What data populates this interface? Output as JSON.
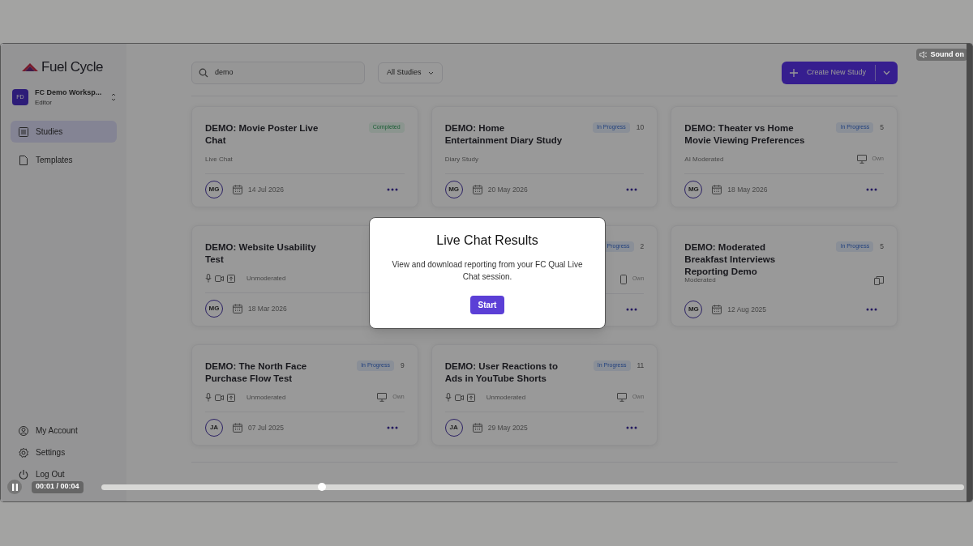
{
  "video": {
    "sound_button": "Sound on",
    "time": "00:01 / 00:04",
    "playing": true,
    "progress": {
      "level": 0.256
    }
  },
  "sidebar": {
    "logo": "Fuel Cycle",
    "workspace": {
      "initials": "FD",
      "name": "FC Demo Worksp...",
      "role": "Editor"
    },
    "nav": [
      {
        "label": "Studies",
        "kind": "list",
        "selected": true
      },
      {
        "label": "Templates",
        "kind": "file",
        "selected": false
      }
    ],
    "footer": [
      {
        "label": "My Account",
        "kind": "account"
      },
      {
        "label": "Settings",
        "kind": "settings"
      },
      {
        "label": "Log Out",
        "kind": "power"
      }
    ]
  },
  "toolbar": {
    "search": {
      "value": "demo"
    },
    "filter": "All Studies",
    "create_button": "Create New Study"
  },
  "studies": [
    {
      "title": "DEMO: Movie Poster Live Chat",
      "status": {
        "label": "Completed",
        "kind": "completed"
      },
      "type": "Live Chat",
      "owner": "MG",
      "date": "14 Jul 2026"
    },
    {
      "title": "DEMO: Home Entertainment Diary Study",
      "status": {
        "label": "In Progress",
        "kind": "in_progress"
      },
      "count": "10",
      "type": "Diary Study",
      "owner": "MG",
      "date": "20 May 2026"
    },
    {
      "title": "DEMO: Theater vs Home Movie Viewing Preferences",
      "status": {
        "label": "In Progress",
        "kind": "in_progress"
      },
      "count": "5",
      "type": "AI Moderated",
      "device": {
        "kind": "desktop",
        "label": "Own"
      },
      "owner": "MG",
      "date": "18 May 2026"
    },
    {
      "title": "DEMO: Website Usability Test",
      "media": true,
      "type": "Unmoderated",
      "owner": "MG",
      "date": "18 Mar 2026"
    },
    {
      "status": {
        "label": "Progress",
        "kind": "in_progress"
      },
      "count": "2",
      "device": {
        "kind": "mobile",
        "label": "Own"
      }
    },
    {
      "title": "DEMO: Moderated Breakfast Interviews Reporting Demo",
      "status": {
        "label": "In Progress",
        "kind": "in_progress"
      },
      "count": "5",
      "type": "Moderated",
      "device": {
        "kind": "multi"
      },
      "owner": "MG",
      "date": "12 Aug 2025"
    },
    {
      "title": "DEMO: The North Face Purchase Flow Test",
      "status": {
        "label": "In Progress",
        "kind": "in_progress"
      },
      "count": "9",
      "media": true,
      "type": "Unmoderated",
      "device": {
        "kind": "desktop",
        "label": "Own"
      },
      "owner": "JA",
      "date": "07 Jul 2025"
    },
    {
      "title": "DEMO: User Reactions to Ads in YouTube Shorts",
      "status": {
        "label": "In Progress",
        "kind": "in_progress"
      },
      "count": "11",
      "media": true,
      "type": "Unmoderated",
      "device": {
        "kind": "desktop",
        "label": "Own"
      },
      "owner": "JA",
      "date": "29 May 2025"
    }
  ],
  "modal": {
    "title": "Live Chat Results",
    "text": "View and download reporting from your FC Qual Live Chat session.",
    "button": "Start"
  }
}
